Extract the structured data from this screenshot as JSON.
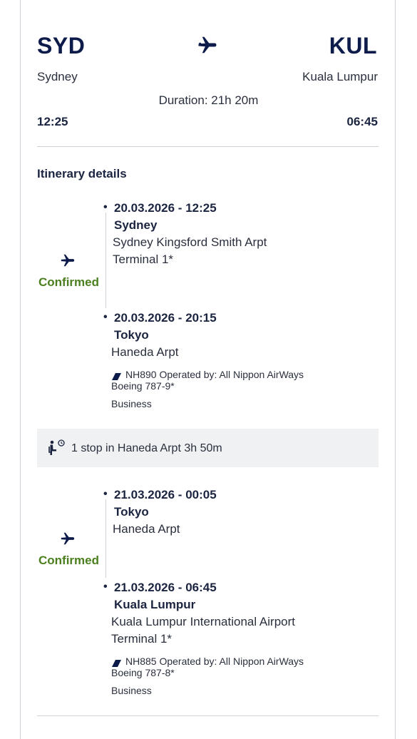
{
  "summary": {
    "origin_code": "SYD",
    "origin_city": "Sydney",
    "destination_code": "KUL",
    "destination_city": "Kuala Lumpur",
    "duration": "Duration: 21h 20m",
    "departure_time": "12:25",
    "arrival_time": "06:45"
  },
  "itinerary": {
    "title": "Itinerary details",
    "segments": [
      {
        "status": "Confirmed",
        "depart": {
          "datetime": "20.03.2026 - 12:25",
          "city": "Sydney",
          "airport": "Sydney Kingsford Smith Arpt",
          "terminal": "Terminal 1*"
        },
        "arrive": {
          "datetime": "20.03.2026 - 20:15",
          "city": "Tokyo",
          "airport": "Haneda Arpt"
        },
        "flight": "NH890 Operated by: All Nippon AirWays",
        "aircraft": "Boeing 787-9*",
        "cabin": "Business"
      },
      {
        "status": "Confirmed",
        "depart": {
          "datetime": "21.03.2026 - 00:05",
          "city": "Tokyo",
          "airport": "Haneda Arpt"
        },
        "arrive": {
          "datetime": "21.03.2026 - 06:45",
          "city": "Kuala Lumpur",
          "airport": "Kuala Lumpur International Airport",
          "terminal": "Terminal 1*"
        },
        "flight": "NH885 Operated by: All Nippon AirWays",
        "aircraft": "Boeing 787-8*",
        "cabin": "Business"
      }
    ],
    "stop": "1 stop in Haneda Arpt 3h 50m"
  },
  "colors": {
    "code": "#0c1b4a",
    "confirmed": "#4b7f1e",
    "stop_bg": "#f0f1f3",
    "divider": "#cfd2d8"
  },
  "icons": {
    "flight": "airplane-icon",
    "stop": "seat-wait-icon",
    "airline": "airline-logo-icon"
  }
}
